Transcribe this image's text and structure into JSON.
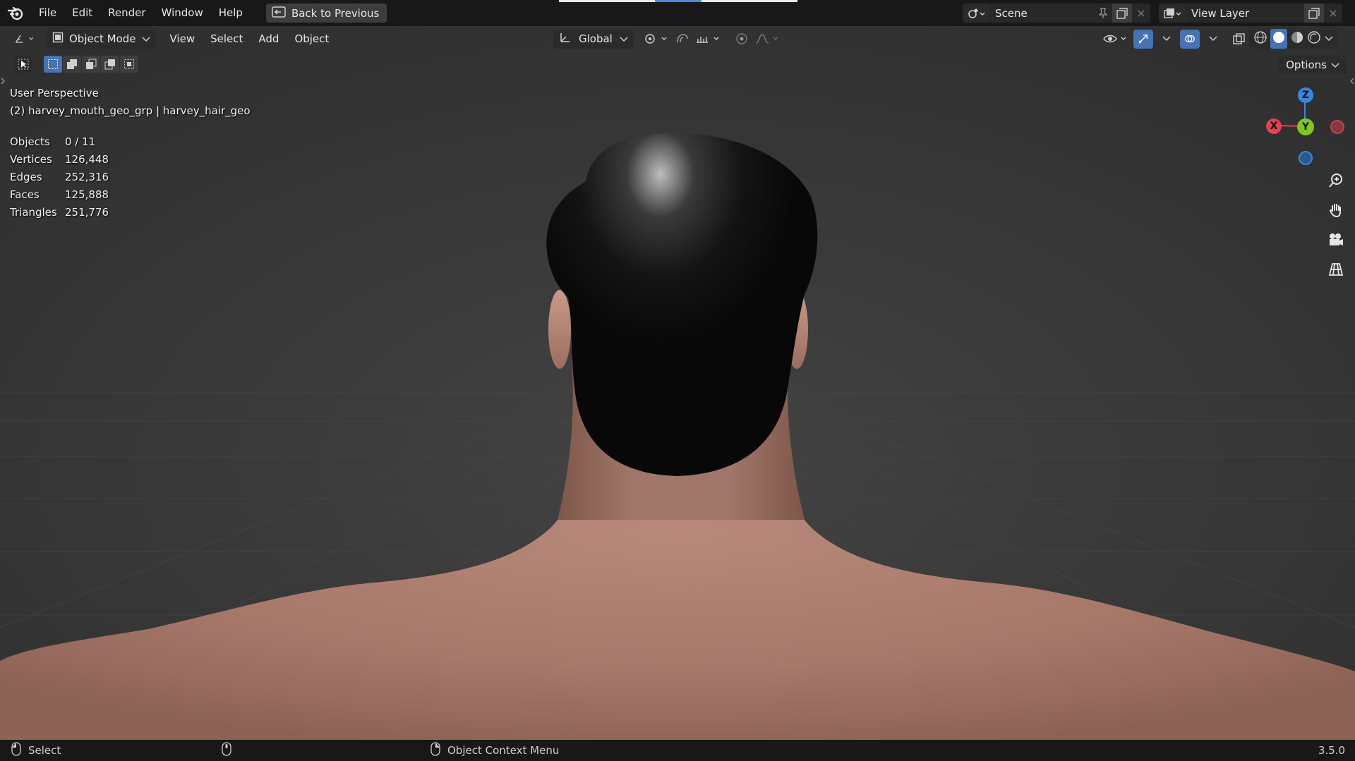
{
  "app": {
    "menus": [
      "File",
      "Edit",
      "Render",
      "Window",
      "Help"
    ],
    "back_button": "Back to Previous",
    "scene_name": "Scene",
    "view_layer": "View Layer"
  },
  "viewport_header": {
    "mode": "Object Mode",
    "menus": [
      "View",
      "Select",
      "Add",
      "Object"
    ],
    "transform_orientation": "Global",
    "options_label": "Options"
  },
  "overlay": {
    "perspective": "User Perspective",
    "active_object": "(2) harvey_mouth_geo_grp | harvey_hair_geo",
    "stats": [
      {
        "label": "Objects",
        "value": "0 / 11"
      },
      {
        "label": "Vertices",
        "value": "126,448"
      },
      {
        "label": "Edges",
        "value": "252,316"
      },
      {
        "label": "Faces",
        "value": "125,888"
      },
      {
        "label": "Triangles",
        "value": "251,776"
      }
    ]
  },
  "gizmo": {
    "x": "X",
    "y": "Y",
    "z": "Z"
  },
  "statusbar": {
    "left_action": "Select",
    "right_action": "Object Context Menu",
    "version": "3.5.0"
  },
  "colors": {
    "x_axis": "#e5404f",
    "y_axis": "#80c723",
    "z_axis": "#3c86db",
    "skin": "#a7786a",
    "hair": "#0f0f0f"
  }
}
